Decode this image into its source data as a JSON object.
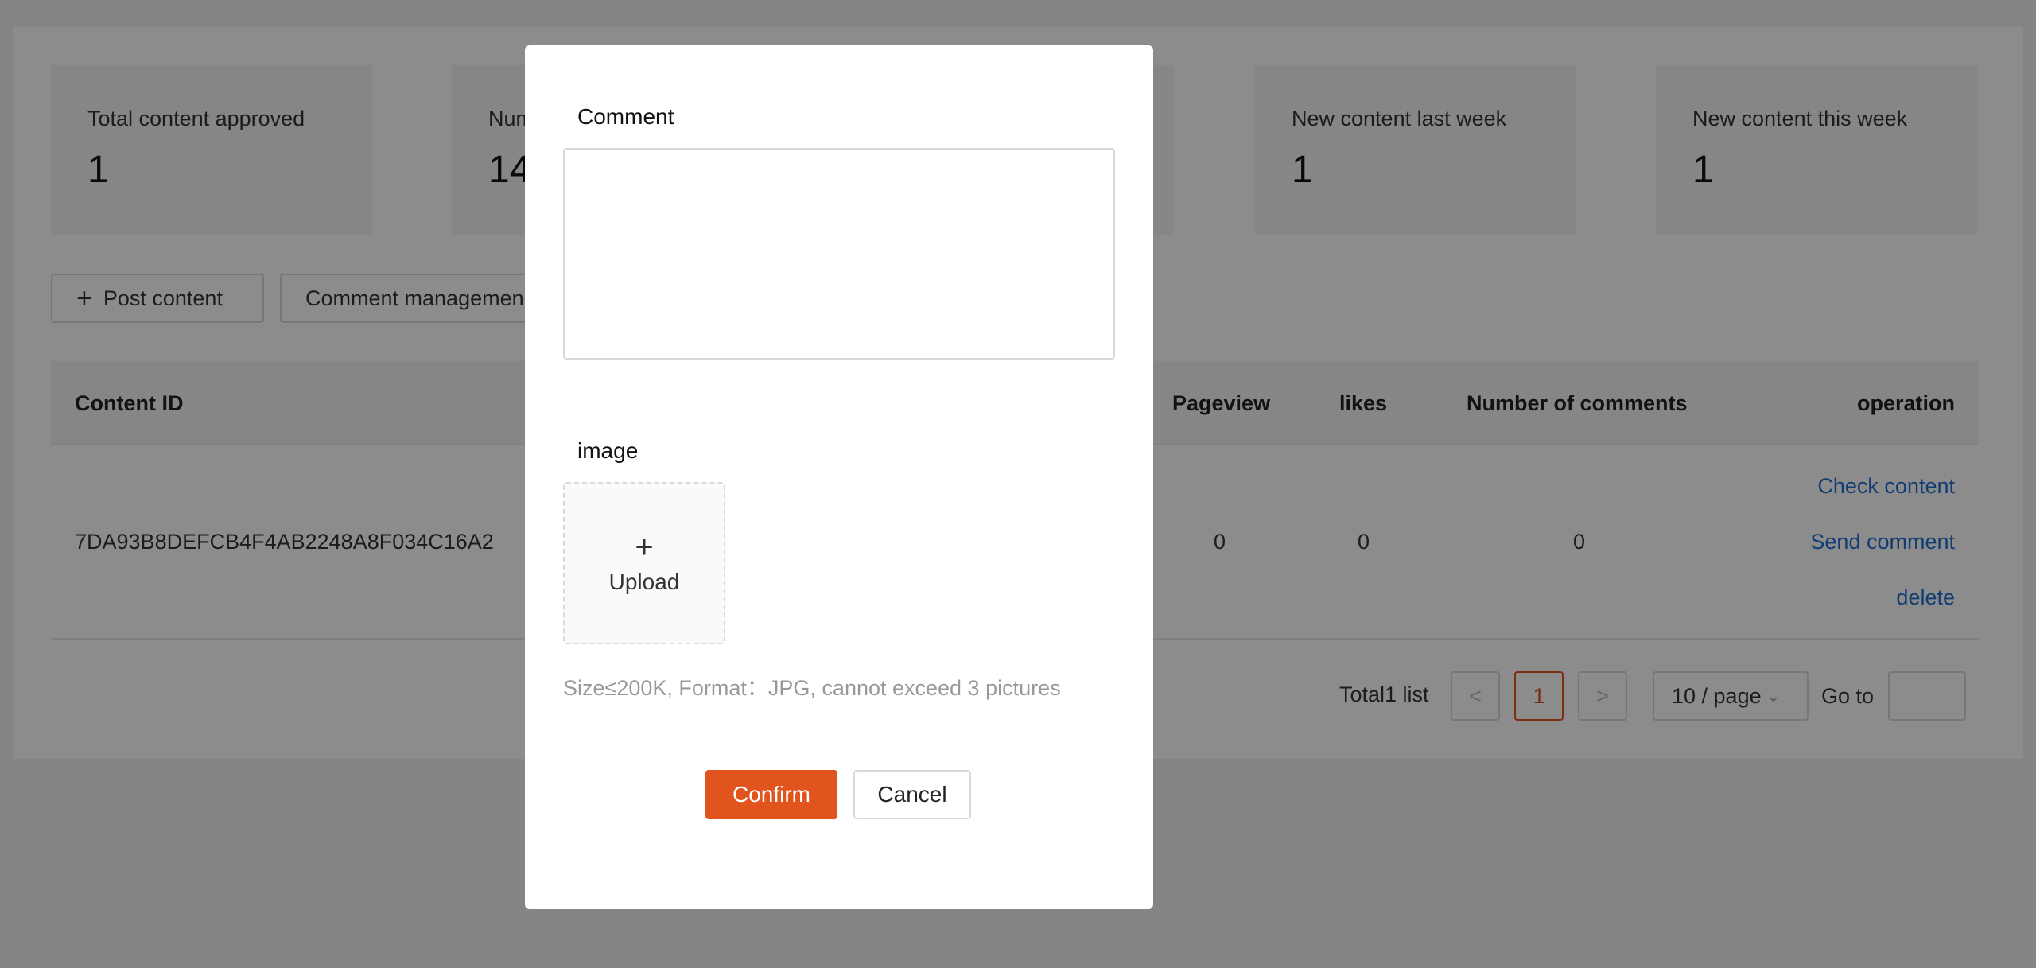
{
  "stats": [
    {
      "label": "Total content approved",
      "value": "1"
    },
    {
      "label": "Num",
      "value": "14"
    },
    {
      "label": "",
      "value": ""
    },
    {
      "label": "New content last week",
      "value": "1"
    },
    {
      "label": "New content this week",
      "value": "1"
    }
  ],
  "toolbar": {
    "post_content": "Post content",
    "comment_management": "Comment managemen"
  },
  "table": {
    "headers": {
      "content_id": "Content ID",
      "pageview": "Pageview",
      "likes": "likes",
      "comments": "Number of comments",
      "operation": "operation"
    },
    "row": {
      "content_id": "7DA93B8DEFCB4F4AB2248A8F034C16A2",
      "pageview": "0",
      "likes": "0",
      "comments": "0",
      "ops": {
        "check": "Check content",
        "send": "Send comment",
        "delete": "delete"
      }
    }
  },
  "pagination": {
    "total": "Total1 list",
    "prev": "<",
    "current": "1",
    "next": ">",
    "page_size": "10 / page",
    "goto_label": "Go to"
  },
  "modal": {
    "comment_label": "Comment",
    "image_label": "image",
    "upload_plus": "+",
    "upload_text": "Upload",
    "hint": "Size≤200K, Format：JPG, cannot exceed 3 pictures",
    "confirm": "Confirm",
    "cancel": "Cancel"
  },
  "colors": {
    "accent": "#e2541e",
    "link": "#1f6fd0"
  }
}
